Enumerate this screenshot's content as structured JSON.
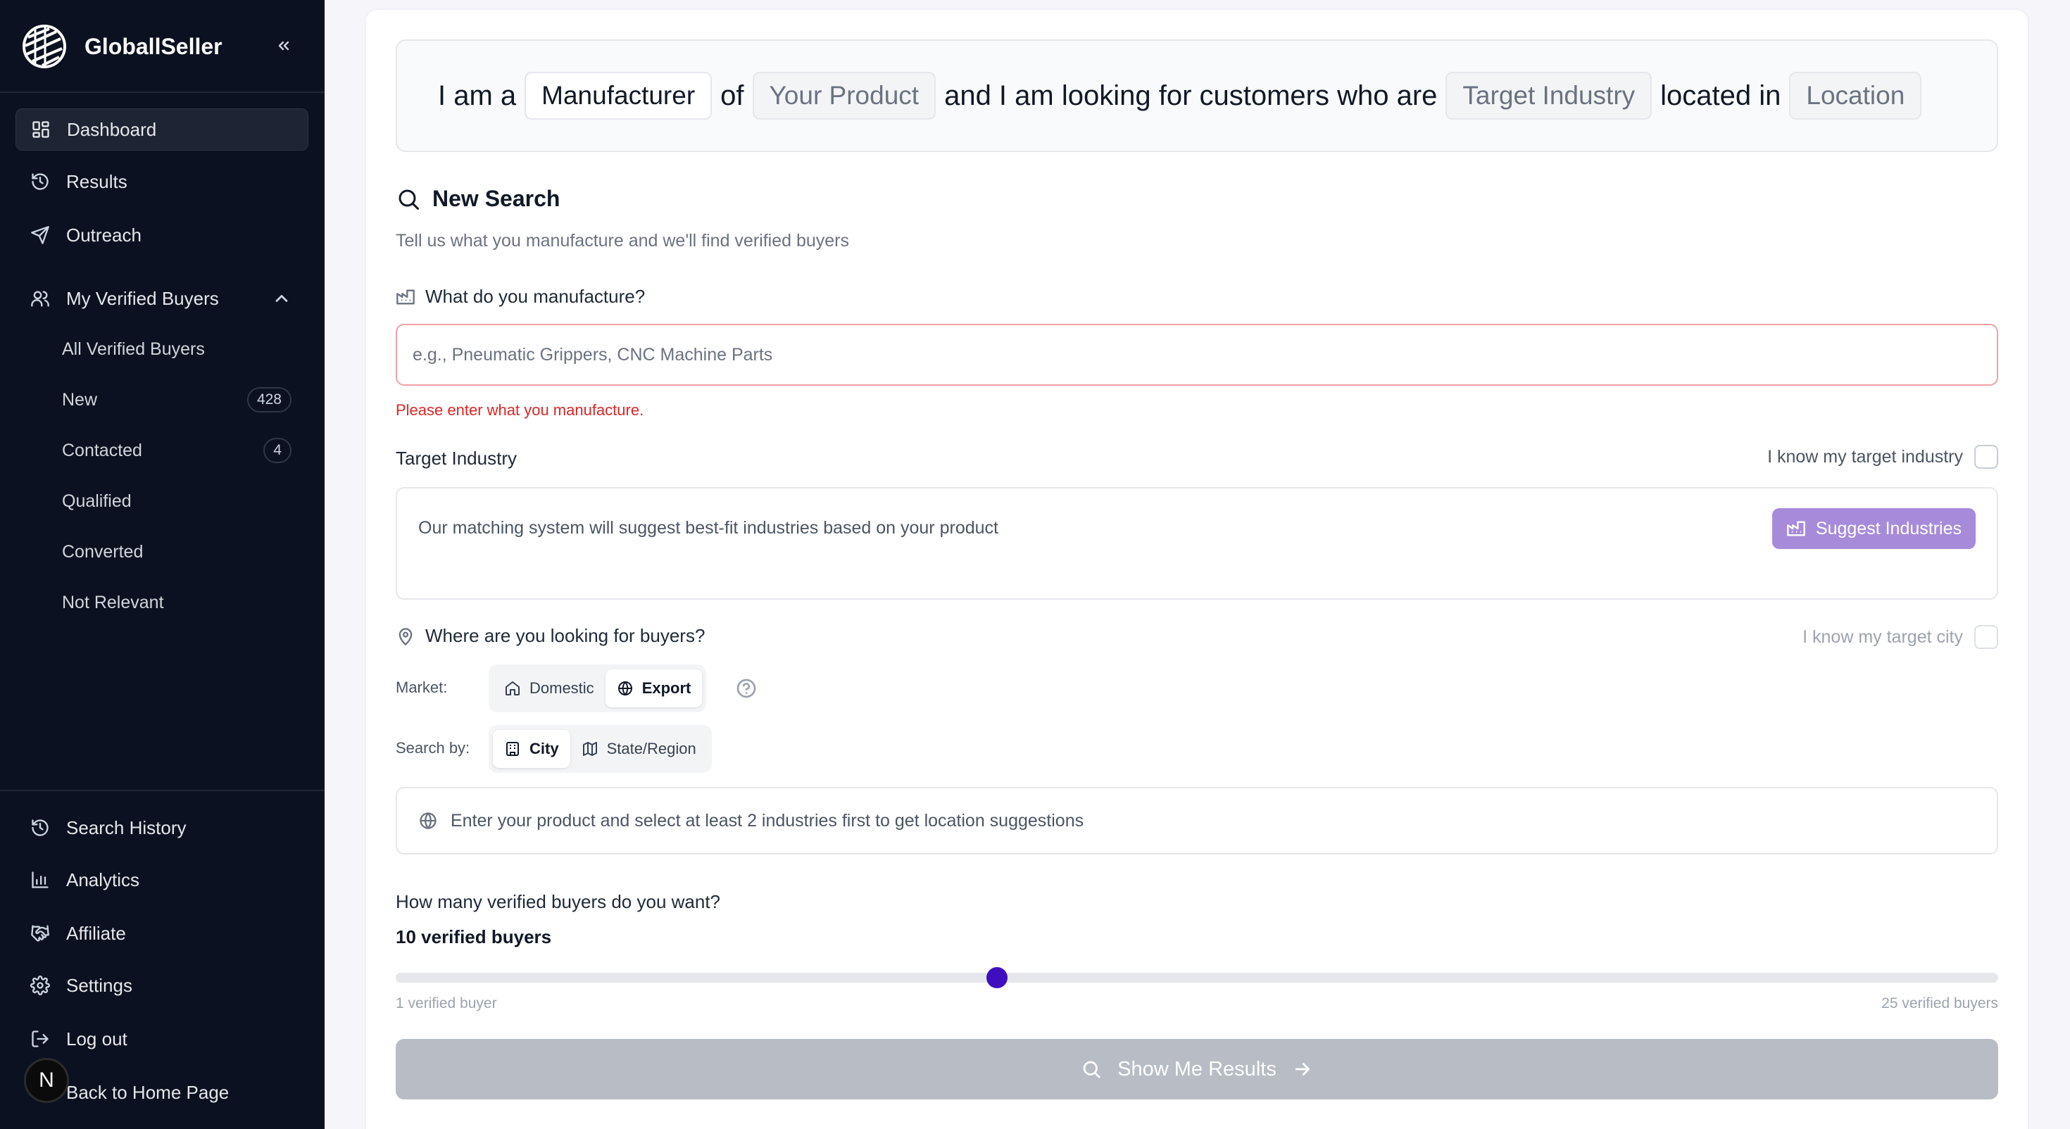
{
  "brand": {
    "name": "GloballSeller"
  },
  "sidebar": {
    "primary": [
      {
        "label": "Dashboard",
        "icon": "dashboard-icon"
      },
      {
        "label": "Results",
        "icon": "history-icon"
      },
      {
        "label": "Outreach",
        "icon": "send-icon"
      }
    ],
    "buyers_group": {
      "label": "My Verified Buyers",
      "icon": "users-icon",
      "items": [
        {
          "label": "All Verified Buyers",
          "count": ""
        },
        {
          "label": "New",
          "count": "428"
        },
        {
          "label": "Contacted",
          "count": "4"
        },
        {
          "label": "Qualified",
          "count": ""
        },
        {
          "label": "Converted",
          "count": ""
        },
        {
          "label": "Not Relevant",
          "count": ""
        }
      ]
    },
    "footer": [
      {
        "label": "Search History",
        "icon": "history-icon"
      },
      {
        "label": "Analytics",
        "icon": "bar-chart-icon"
      },
      {
        "label": "Affiliate",
        "icon": "handshake-icon"
      },
      {
        "label": "Settings",
        "icon": "gear-icon"
      },
      {
        "label": "Log out",
        "icon": "logout-icon"
      },
      {
        "label": "Back to Home Page",
        "icon": "arrow-left-icon"
      }
    ],
    "avatar_letter": "N"
  },
  "sentence": {
    "w1": "I am a",
    "role": "Manufacturer",
    "w2": "of",
    "product": "Your Product",
    "w3": "and I am looking for customers who are",
    "industry": "Target Industry",
    "w4": "located in",
    "location": "Location"
  },
  "search": {
    "title": "New Search",
    "subtitle": "Tell us what you manufacture and we'll find verified buyers",
    "manufacture_label": "What do you manufacture?",
    "manufacture_placeholder": "e.g., Pneumatic Grippers, CNC Machine Parts",
    "manufacture_value": "",
    "error": "Please enter what you manufacture."
  },
  "industry": {
    "label": "Target Industry",
    "know_label": "I know my target industry",
    "hint": "Our matching system will suggest best-fit industries based on your product",
    "suggest_label": "Suggest Industries"
  },
  "location": {
    "label": "Where are you looking for buyers?",
    "know_label": "I know my target city",
    "market_label": "Market:",
    "market_options": [
      "Domestic",
      "Export"
    ],
    "market_selected": "Export",
    "search_by_label": "Search by:",
    "search_by_options": [
      "City",
      "State/Region"
    ],
    "search_by_selected": "City",
    "hint": "Enter your product and select at least 2 industries first to get location suggestions"
  },
  "quantity": {
    "question": "How many verified buyers do you want?",
    "value_label": "10 verified buyers",
    "value": 10,
    "min": 1,
    "max": 25,
    "min_label": "1 verified buyer",
    "max_label": "25 verified buyers"
  },
  "cta": {
    "label": "Show Me Results"
  },
  "colors": {
    "sidebar_bg": "#0b1120",
    "accent_purple": "#a78bda",
    "slider_thumb": "#3f0fbf",
    "error": "#dc2626",
    "cta_disabled": "#b8bcc4"
  }
}
